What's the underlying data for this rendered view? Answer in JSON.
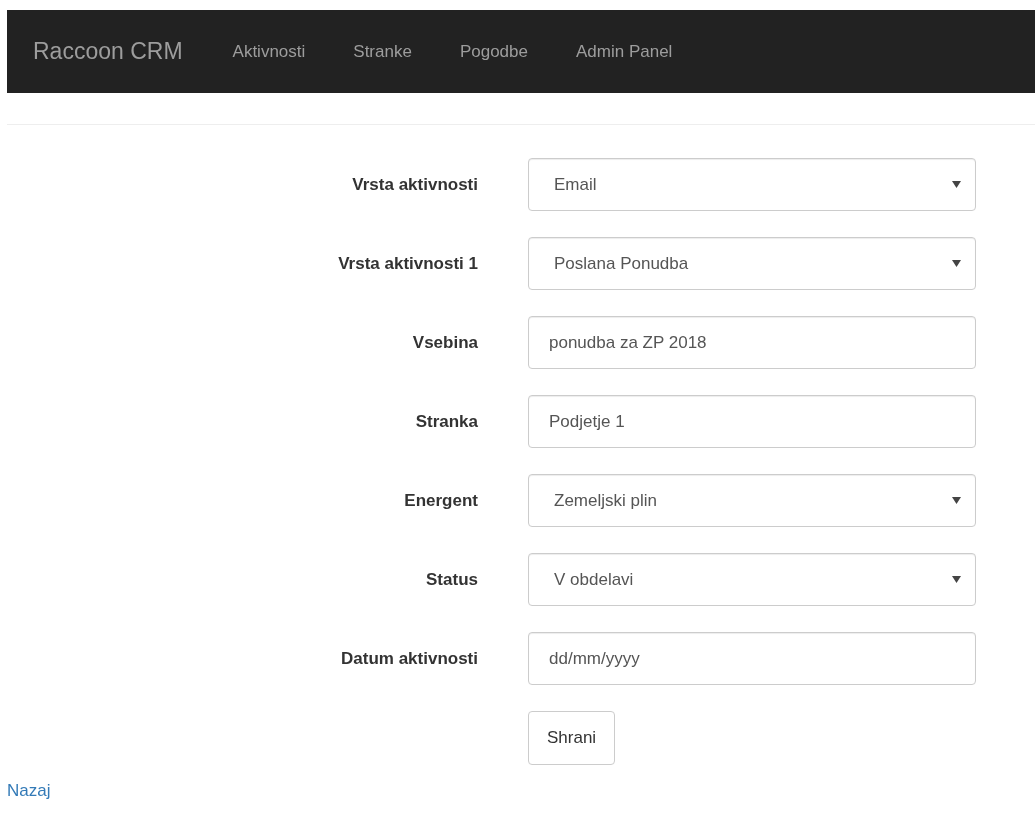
{
  "navbar": {
    "brand": "Raccoon CRM",
    "links": [
      "Aktivnosti",
      "Stranke",
      "Pogodbe",
      "Admin Panel"
    ]
  },
  "form": {
    "fields": [
      {
        "label": "Vrsta aktivnosti",
        "kind": "select",
        "value": "Email"
      },
      {
        "label": "Vrsta aktivnosti 1",
        "kind": "select",
        "value": "Poslana Ponudba"
      },
      {
        "label": "Vsebina",
        "kind": "input",
        "value": "ponudba za ZP 2018"
      },
      {
        "label": "Stranka",
        "kind": "input",
        "value": "Podjetje 1"
      },
      {
        "label": "Energent",
        "kind": "select",
        "value": "Zemeljski plin"
      },
      {
        "label": "Status",
        "kind": "select",
        "value": "V obdelavi"
      },
      {
        "label": "Datum aktivnosti",
        "kind": "date",
        "placeholder": "dd/mm/yyyy"
      }
    ],
    "submit": "Shrani"
  },
  "back_link": "Nazaj"
}
